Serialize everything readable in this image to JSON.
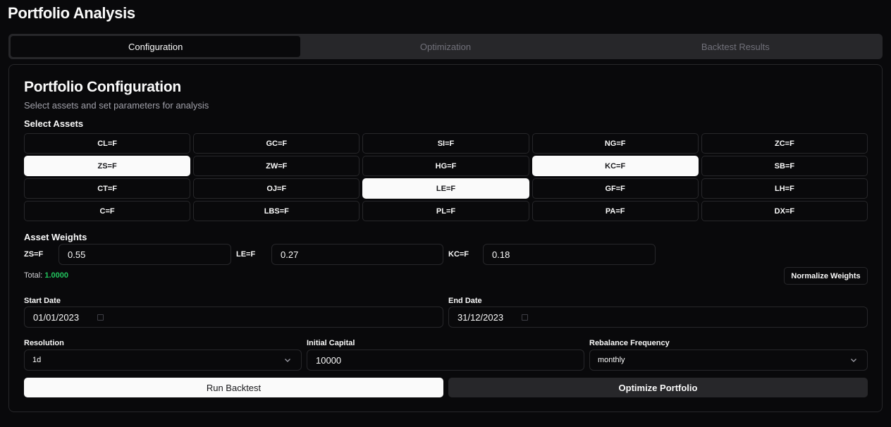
{
  "page": {
    "title": "Portfolio Analysis"
  },
  "tabs": [
    {
      "label": "Configuration",
      "active": true
    },
    {
      "label": "Optimization",
      "active": false
    },
    {
      "label": "Backtest Results",
      "active": false
    }
  ],
  "card": {
    "title": "Portfolio Configuration",
    "description": "Select assets and set parameters for analysis"
  },
  "assets": {
    "label": "Select Assets",
    "items": [
      {
        "symbol": "CL=F",
        "selected": false
      },
      {
        "symbol": "GC=F",
        "selected": false
      },
      {
        "symbol": "SI=F",
        "selected": false
      },
      {
        "symbol": "NG=F",
        "selected": false
      },
      {
        "symbol": "ZC=F",
        "selected": false
      },
      {
        "symbol": "ZS=F",
        "selected": true
      },
      {
        "symbol": "ZW=F",
        "selected": false
      },
      {
        "symbol": "HG=F",
        "selected": false
      },
      {
        "symbol": "KC=F",
        "selected": true
      },
      {
        "symbol": "SB=F",
        "selected": false
      },
      {
        "symbol": "CT=F",
        "selected": false
      },
      {
        "symbol": "OJ=F",
        "selected": false
      },
      {
        "symbol": "LE=F",
        "selected": true
      },
      {
        "symbol": "GF=F",
        "selected": false
      },
      {
        "symbol": "LH=F",
        "selected": false
      },
      {
        "symbol": "C=F",
        "selected": false
      },
      {
        "symbol": "LBS=F",
        "selected": false
      },
      {
        "symbol": "PL=F",
        "selected": false
      },
      {
        "symbol": "PA=F",
        "selected": false
      },
      {
        "symbol": "DX=F",
        "selected": false
      }
    ]
  },
  "weights": {
    "label": "Asset Weights",
    "items": [
      {
        "symbol": "ZS=F",
        "value": "0.55"
      },
      {
        "symbol": "LE=F",
        "value": "0.27"
      },
      {
        "symbol": "KC=F",
        "value": "0.18"
      }
    ],
    "total_label": "Total:",
    "total_value": "1.0000",
    "normalize_label": "Normalize Weights"
  },
  "dates": {
    "start_label": "Start Date",
    "start_value": "01/01/2023",
    "end_label": "End Date",
    "end_value": "31/12/2023"
  },
  "params": {
    "resolution_label": "Resolution",
    "resolution_value": "1d",
    "capital_label": "Initial Capital",
    "capital_value": "10000",
    "rebalance_label": "Rebalance Frequency",
    "rebalance_value": "monthly"
  },
  "actions": {
    "run_label": "Run Backtest",
    "optimize_label": "Optimize Portfolio"
  },
  "colors": {
    "background": "#09090b",
    "border": "#27272a",
    "accent_green": "#22c55e",
    "selected_bg": "#fafafa"
  }
}
